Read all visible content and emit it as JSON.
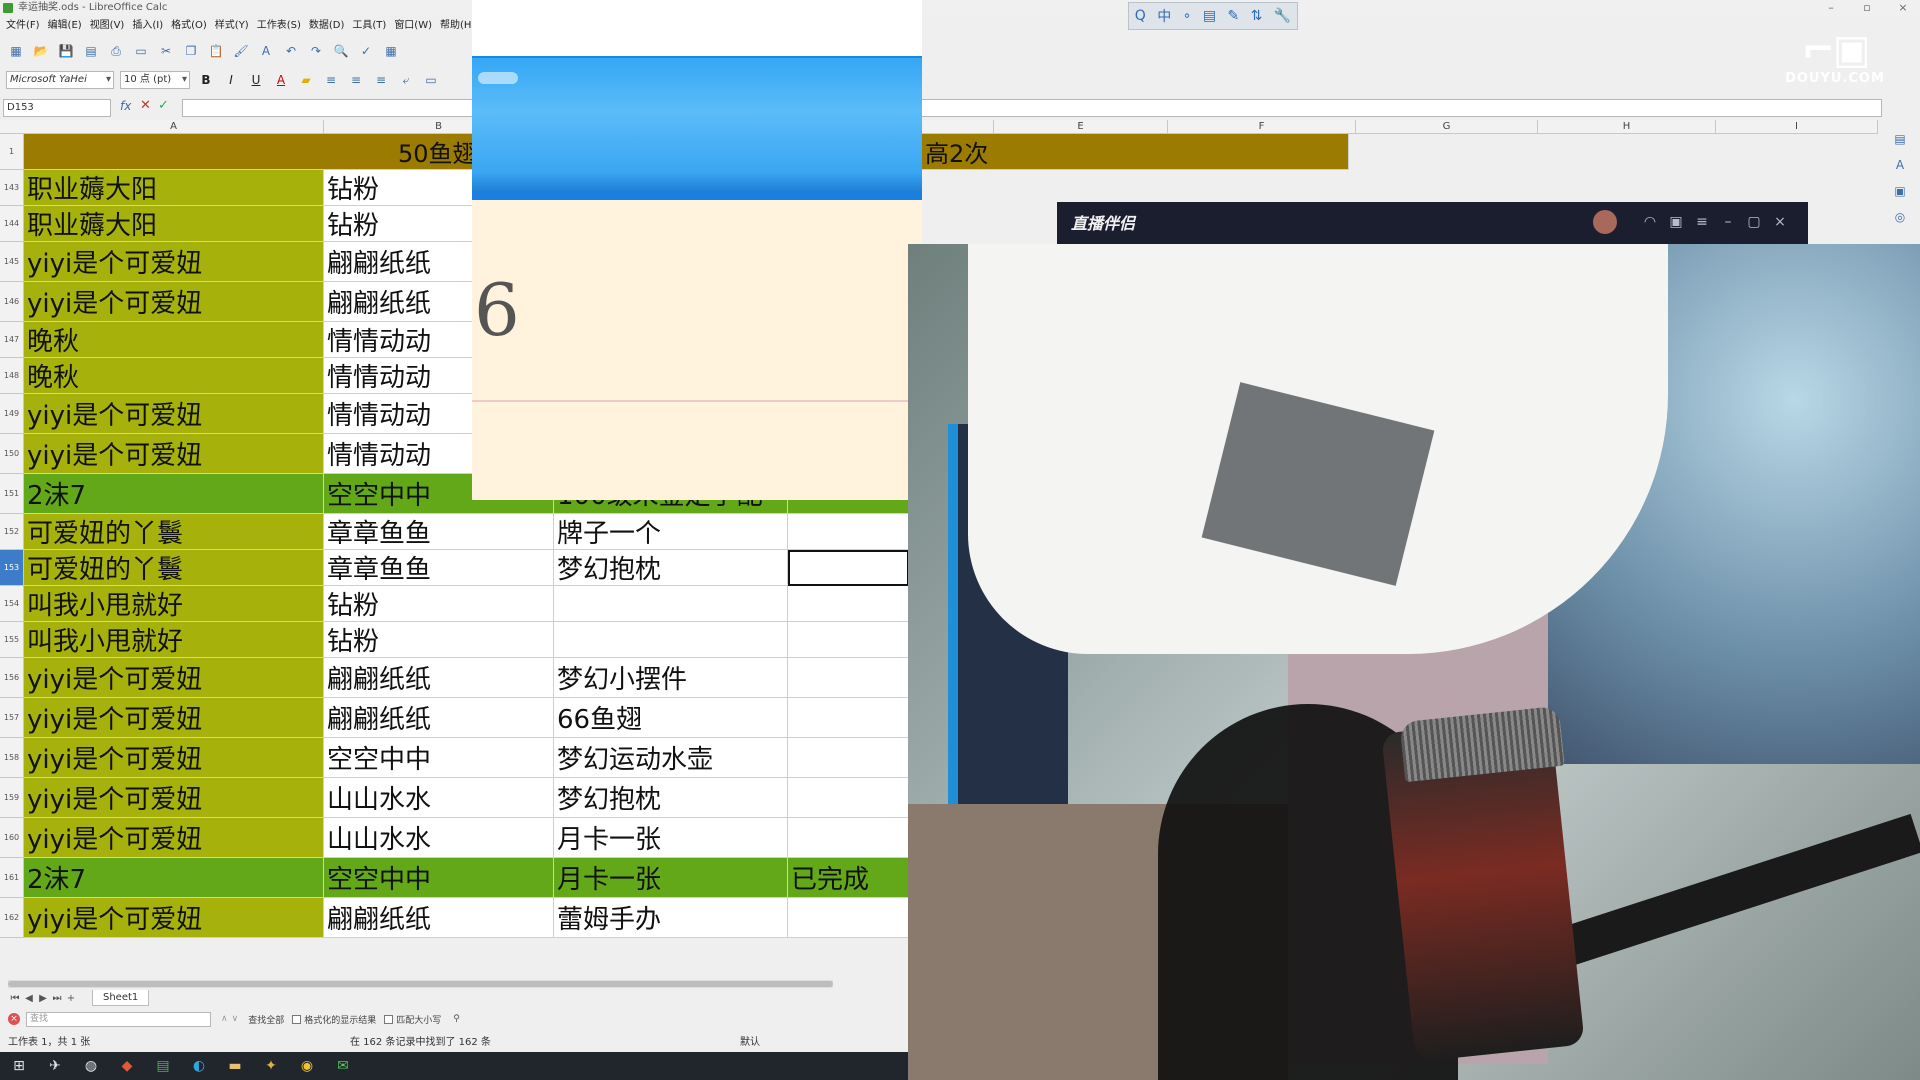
{
  "titlebar": {
    "title": "幸运抽奖.ods - LibreOffice Calc"
  },
  "menu": [
    "文件(F)",
    "编辑(E)",
    "视图(V)",
    "插入(I)",
    "格式(O)",
    "样式(Y)",
    "工作表(S)",
    "数据(D)",
    "工具(T)",
    "窗口(W)",
    "帮助(H)"
  ],
  "format": {
    "font_name": "Microsoft YaHei",
    "font_size": "10 点 (pt)"
  },
  "namebox": "D153",
  "columns": [
    "A",
    "B",
    "",
    "E",
    "F",
    "G",
    "H",
    "I"
  ],
  "header_row": {
    "row": "1",
    "left_text": "50鱼翅",
    "right_text": "高2次"
  },
  "rows": [
    {
      "num": "143",
      "style": "olive",
      "a": "职业薅大阳",
      "b": "钻粉",
      "c": "",
      "d": ""
    },
    {
      "num": "144",
      "style": "olive",
      "a": "职业薅大阳",
      "b": "钻粉",
      "c": "",
      "d": ""
    },
    {
      "num": "145",
      "style": "olive",
      "a": "yiyi是个可爱妞",
      "b": "翩翩纸纸",
      "c": "",
      "d": ""
    },
    {
      "num": "146",
      "style": "olive",
      "a": "yiyi是个可爱妞",
      "b": "翩翩纸纸",
      "c": "",
      "d": ""
    },
    {
      "num": "147",
      "style": "olive",
      "a": "晚秋",
      "b": "情情动动",
      "c": "",
      "d": ""
    },
    {
      "num": "148",
      "style": "olive",
      "a": "晚秋",
      "b": "情情动动",
      "c": "",
      "d": ""
    },
    {
      "num": "149",
      "style": "olive",
      "a": "yiyi是个可爱妞",
      "b": "情情动动",
      "c": "",
      "d": ""
    },
    {
      "num": "150",
      "style": "olive",
      "a": "yiyi是个可爱妞",
      "b": "情情动动",
      "c": "",
      "d": ""
    },
    {
      "num": "151",
      "style": "green",
      "a": "2沫7",
      "b": "空空中中",
      "c": "100级未鉴定手配",
      "d": ""
    },
    {
      "num": "152",
      "style": "olive",
      "a": "可爱妞的丫鬟",
      "b": "章章鱼鱼",
      "c": "牌子一个",
      "d": ""
    },
    {
      "num": "153",
      "style": "olive",
      "a": "可爱妞的丫鬟",
      "b": "章章鱼鱼",
      "c": "梦幻抱枕",
      "d": ""
    },
    {
      "num": "154",
      "style": "olive",
      "a": "叫我小甩就好",
      "b": "钻粉",
      "c": "",
      "d": ""
    },
    {
      "num": "155",
      "style": "olive",
      "a": "叫我小甩就好",
      "b": "钻粉",
      "c": "",
      "d": ""
    },
    {
      "num": "156",
      "style": "olive",
      "a": "yiyi是个可爱妞",
      "b": "翩翩纸纸",
      "c": "梦幻小摆件",
      "d": ""
    },
    {
      "num": "157",
      "style": "olive",
      "a": "yiyi是个可爱妞",
      "b": "翩翩纸纸",
      "c": "66鱼翅",
      "d": ""
    },
    {
      "num": "158",
      "style": "olive",
      "a": "yiyi是个可爱妞",
      "b": "空空中中",
      "c": "梦幻运动水壶",
      "d": ""
    },
    {
      "num": "159",
      "style": "olive",
      "a": "yiyi是个可爱妞",
      "b": "山山水水",
      "c": "梦幻抱枕",
      "d": ""
    },
    {
      "num": "160",
      "style": "olive",
      "a": "yiyi是个可爱妞",
      "b": "山山水水",
      "c": "月卡一张",
      "d": ""
    },
    {
      "num": "161",
      "style": "green",
      "a": "2沫7",
      "b": "空空中中",
      "c": "月卡一张",
      "d": "已完成"
    },
    {
      "num": "162",
      "style": "olive",
      "a": "yiyi是个可爱妞",
      "b": "翩翩纸纸",
      "c": "蕾姆手办",
      "d": ""
    }
  ],
  "sheet_tab": "Sheet1",
  "findbar": {
    "placeholder": "查找",
    "find_all": "查找全部",
    "formatted": "格式化的显示结果",
    "match_case": "匹配大小写"
  },
  "statusbar": {
    "sheet": "工作表 1，共 1 张",
    "found": "在 162 条记录中找到了 162 条",
    "style": "默认"
  },
  "overlay": {
    "number": "6"
  },
  "ime": [
    "Q",
    "中",
    "∘",
    "▤",
    "✎",
    "⇅",
    "🔧"
  ],
  "watermark": {
    "logo_text": "DOUYU.COM"
  },
  "companion": {
    "title": "直播伴侣"
  },
  "colors": {
    "olive": "#a6b20b",
    "green": "#62a818",
    "header": "#9b7b00"
  }
}
